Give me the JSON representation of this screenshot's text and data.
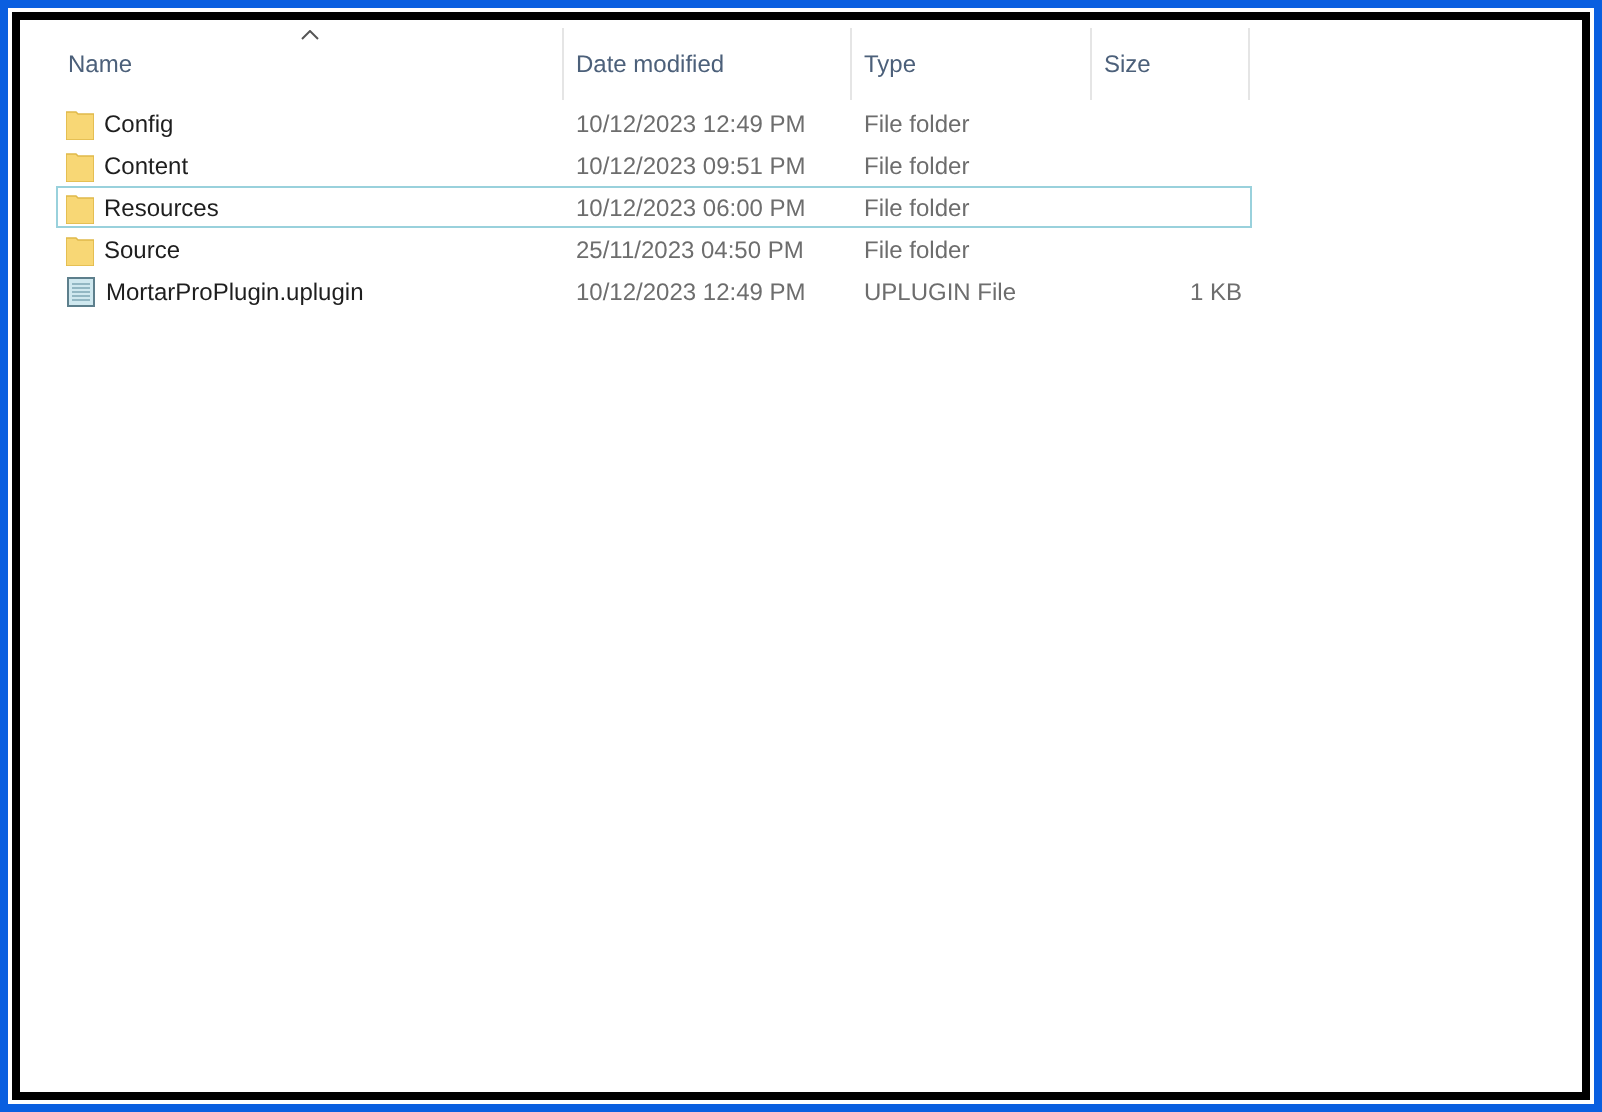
{
  "columns": [
    {
      "label": "Name",
      "sorted": true
    },
    {
      "label": "Date modified",
      "sorted": false
    },
    {
      "label": "Type",
      "sorted": false
    },
    {
      "label": "Size",
      "sorted": false
    }
  ],
  "rows": [
    {
      "kind": "folder",
      "name": "Config",
      "date": "10/12/2023 12:49 PM",
      "type": "File folder",
      "focused": false
    },
    {
      "kind": "folder",
      "name": "Content",
      "date": "10/12/2023 09:51 PM",
      "type": "File folder",
      "focused": false
    },
    {
      "kind": "folder",
      "name": "Resources",
      "date": "10/12/2023 06:00 PM",
      "type": "File folder",
      "focused": true
    },
    {
      "kind": "folder",
      "name": "Source",
      "date": "25/11/2023 04:50 PM",
      "type": "File folder",
      "focused": false
    },
    {
      "kind": "file",
      "name": "MortarProPlugin.uplugin",
      "date": "10/12/2023 12:49 PM",
      "type": "UPLUGIN File",
      "size": "1 KB",
      "focused": false
    }
  ]
}
